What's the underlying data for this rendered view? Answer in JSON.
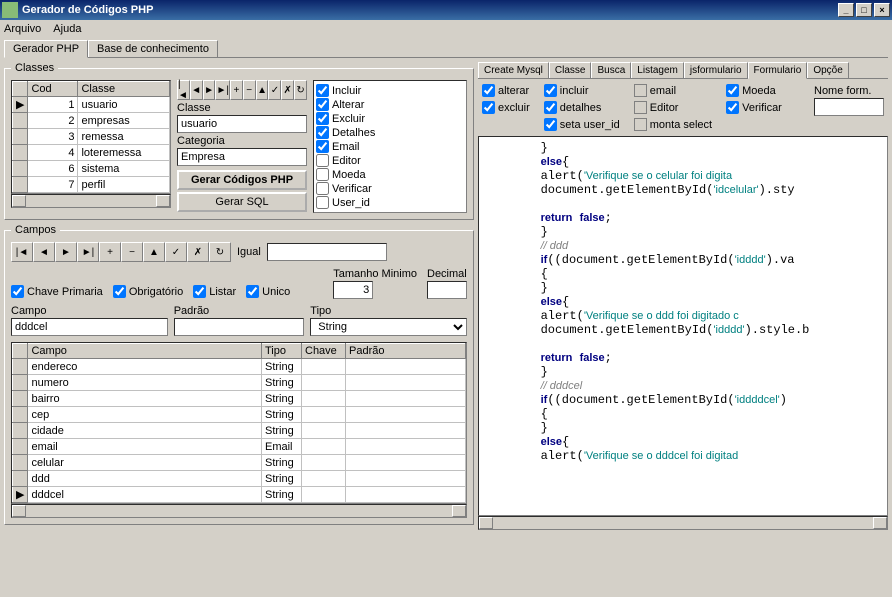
{
  "title": "Gerador de Códigos PHP",
  "menu": {
    "arquivo": "Arquivo",
    "ajuda": "Ajuda"
  },
  "tabs": {
    "gerador": "Gerador PHP",
    "base": "Base de conhecimento"
  },
  "classes": {
    "legend": "Classes",
    "cols": {
      "cod": "Cod",
      "classe": "Classe"
    },
    "rows": [
      {
        "cod": "1",
        "classe": "usuario"
      },
      {
        "cod": "2",
        "classe": "empresas"
      },
      {
        "cod": "3",
        "classe": "remessa"
      },
      {
        "cod": "4",
        "classe": "loteremessa"
      },
      {
        "cod": "6",
        "classe": "sistema"
      },
      {
        "cod": "7",
        "classe": "perfil"
      }
    ],
    "classe_label": "Classe",
    "classe_value": "usuario",
    "categoria_label": "Categoria",
    "categoria_value": "Empresa",
    "btn_gerar": "Gerar Códigos PHP",
    "btn_sql": "Gerar SQL",
    "checks": {
      "incluir": "Incluir",
      "alterar": "Alterar",
      "excluir": "Excluir",
      "detalhes": "Detalhes",
      "email": "Email",
      "editor": "Editor",
      "moeda": "Moeda",
      "verificar": "Verificar",
      "user_id": "User_id"
    }
  },
  "campos": {
    "legend": "Campos",
    "igual_label": "Igual",
    "tamanho_label": "Tamanho Minimo",
    "tamanho_value": "3",
    "decimal_label": "Decimal",
    "chave_primaria": "Chave Primaria",
    "obrigatorio": "Obrigatório",
    "listar": "Listar",
    "unico": "Unico",
    "campo_label": "Campo",
    "campo_value": "dddcel",
    "padrao_label": "Padrão",
    "tipo_label": "Tipo",
    "tipo_value": "String",
    "cols": {
      "campo": "Campo",
      "tipo": "Tipo",
      "chave": "Chave",
      "padrao": "Padrão"
    },
    "rows": [
      {
        "campo": "endereco",
        "tipo": "String"
      },
      {
        "campo": "numero",
        "tipo": "String"
      },
      {
        "campo": "bairro",
        "tipo": "String"
      },
      {
        "campo": "cep",
        "tipo": "String"
      },
      {
        "campo": "cidade",
        "tipo": "String"
      },
      {
        "campo": "email",
        "tipo": "Email"
      },
      {
        "campo": "celular",
        "tipo": "String"
      },
      {
        "campo": "ddd",
        "tipo": "String"
      },
      {
        "campo": "dddcel",
        "tipo": "String"
      }
    ]
  },
  "right": {
    "tabs": {
      "create_mysql": "Create Mysql",
      "classe": "Classe",
      "busca": "Busca",
      "listagem": "Listagem",
      "jsformulario": "jsformulario",
      "formulario": "Formulario",
      "opcoes": "Opçõe"
    },
    "checks": {
      "alterar": "alterar",
      "incluir": "incluir",
      "email": "email",
      "moeda": "Moeda",
      "excluir": "excluir",
      "detalhes": "detalhes",
      "editor": "Editor",
      "verificar": "Verificar",
      "seta_user_id": "seta user_id",
      "monta_select": "monta select"
    },
    "nome_form": "Nome form.",
    "code_lines": [
      "        }",
      "        else{",
      "        alert('Verifique se o celular foi digita",
      "        document.getElementById('idcelular').sty",
      "",
      "        return false;",
      "        }",
      "        // ddd",
      "        if((document.getElementById('idddd').va",
      "        {",
      "        }",
      "        else{",
      "        alert('Verifique se o ddd foi digitado c",
      "        document.getElementById('idddd').style.b",
      "",
      "        return false;",
      "        }",
      "        // dddcel",
      "        if((document.getElementById('iddddcel')",
      "        {",
      "        }",
      "        else{",
      "        alert('Verifique se o dddcel foi digitad"
    ]
  }
}
